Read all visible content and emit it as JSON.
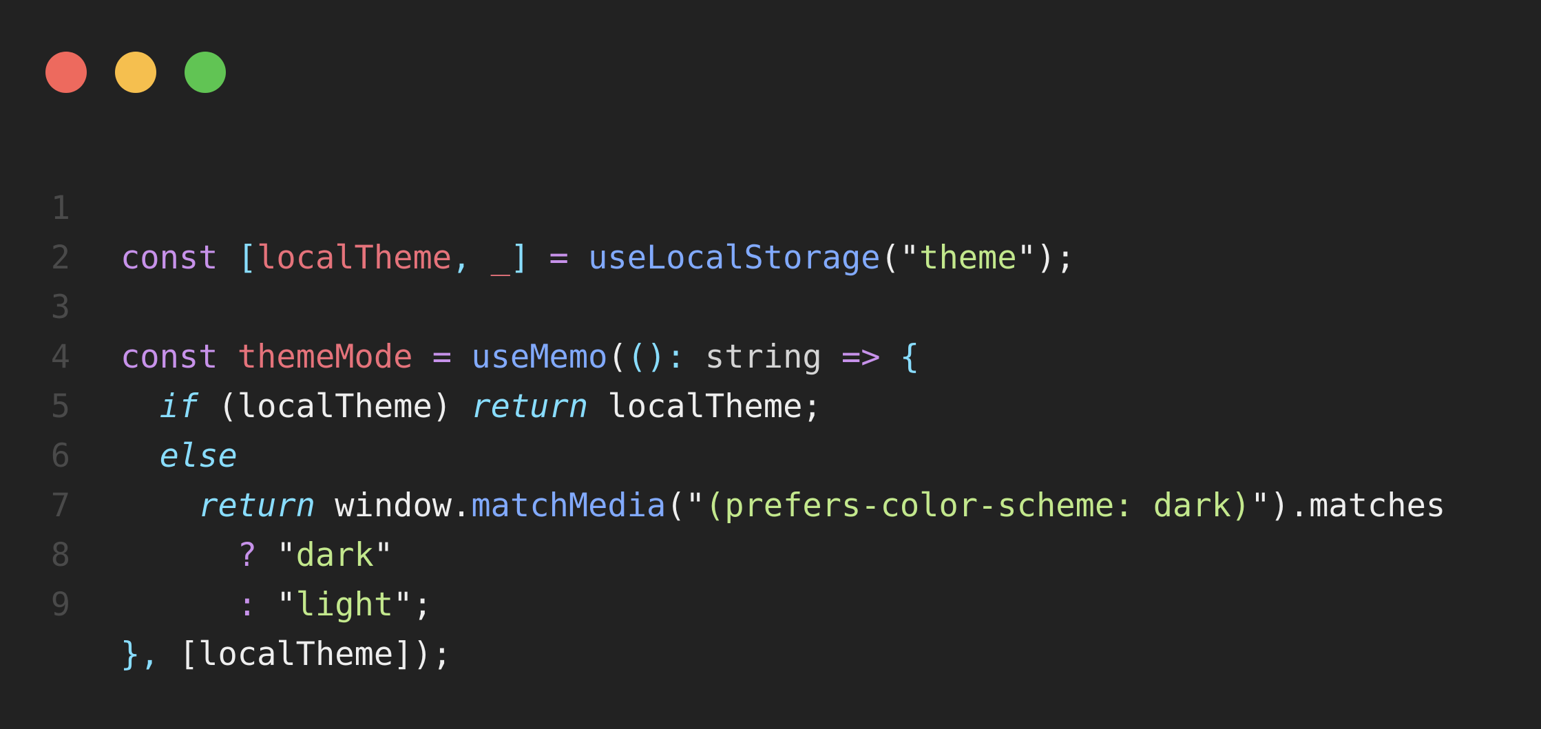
{
  "window": {
    "traffic_lights": [
      {
        "name": "close-button",
        "color": "#ed6a5e"
      },
      {
        "name": "minimize-button",
        "color": "#f5bf4f"
      },
      {
        "name": "zoom-button",
        "color": "#61c454"
      }
    ]
  },
  "colors": {
    "background": "#222222",
    "keyword": "#c792ea",
    "variable": "#e5737b",
    "function": "#82aaff",
    "string": "#c3e88d",
    "punctuation": "#89ddff",
    "text": "#eeeeee",
    "line_number": "#4a4a4a"
  },
  "code": {
    "line_numbers": [
      "1",
      "2",
      "3",
      "4",
      "5",
      "6",
      "7",
      "8",
      "9"
    ],
    "lines": [
      [
        {
          "t": "const",
          "c": "kw"
        },
        {
          "t": " ",
          "c": "txt"
        },
        {
          "t": "[",
          "c": "pun"
        },
        {
          "t": "localTheme",
          "c": "var"
        },
        {
          "t": ", ",
          "c": "pun"
        },
        {
          "t": "_",
          "c": "var"
        },
        {
          "t": "]",
          "c": "pun"
        },
        {
          "t": " ",
          "c": "txt"
        },
        {
          "t": "=",
          "c": "kw"
        },
        {
          "t": " ",
          "c": "txt"
        },
        {
          "t": "useLocalStorage",
          "c": "fn"
        },
        {
          "t": "(\"",
          "c": "txt"
        },
        {
          "t": "theme",
          "c": "str"
        },
        {
          "t": "\");",
          "c": "txt"
        }
      ],
      [],
      [
        {
          "t": "const",
          "c": "kw"
        },
        {
          "t": " ",
          "c": "txt"
        },
        {
          "t": "themeMode",
          "c": "var"
        },
        {
          "t": " ",
          "c": "txt"
        },
        {
          "t": "=",
          "c": "kw"
        },
        {
          "t": " ",
          "c": "txt"
        },
        {
          "t": "useMemo",
          "c": "fn"
        },
        {
          "t": "(",
          "c": "txt"
        },
        {
          "t": "()",
          "c": "pun"
        },
        {
          "t": ":",
          "c": "pun"
        },
        {
          "t": " ",
          "c": "txt"
        },
        {
          "t": "string",
          "c": "typ"
        },
        {
          "t": " ",
          "c": "txt"
        },
        {
          "t": "=>",
          "c": "kw"
        },
        {
          "t": " ",
          "c": "txt"
        },
        {
          "t": "{",
          "c": "pun"
        }
      ],
      [
        {
          "t": "  ",
          "c": "txt"
        },
        {
          "t": "if",
          "c": "it"
        },
        {
          "t": " (localTheme) ",
          "c": "txt"
        },
        {
          "t": "return",
          "c": "it"
        },
        {
          "t": " localTheme;",
          "c": "txt"
        }
      ],
      [
        {
          "t": "  ",
          "c": "txt"
        },
        {
          "t": "else",
          "c": "it"
        }
      ],
      [
        {
          "t": "    ",
          "c": "txt"
        },
        {
          "t": "return",
          "c": "it"
        },
        {
          "t": " window.",
          "c": "txt"
        },
        {
          "t": "matchMedia",
          "c": "fn"
        },
        {
          "t": "(\"",
          "c": "txt"
        },
        {
          "t": "(prefers-color-scheme: dark)",
          "c": "str"
        },
        {
          "t": "\").matches",
          "c": "txt"
        }
      ],
      [
        {
          "t": "      ",
          "c": "txt"
        },
        {
          "t": "?",
          "c": "kw"
        },
        {
          "t": " \"",
          "c": "txt"
        },
        {
          "t": "dark",
          "c": "str"
        },
        {
          "t": "\"",
          "c": "txt"
        }
      ],
      [
        {
          "t": "      ",
          "c": "txt"
        },
        {
          "t": ":",
          "c": "kw"
        },
        {
          "t": " \"",
          "c": "txt"
        },
        {
          "t": "light",
          "c": "str"
        },
        {
          "t": "\";",
          "c": "txt"
        }
      ],
      [
        {
          "t": "}, ",
          "c": "pun"
        },
        {
          "t": "[localTheme]);",
          "c": "txt"
        }
      ]
    ]
  }
}
